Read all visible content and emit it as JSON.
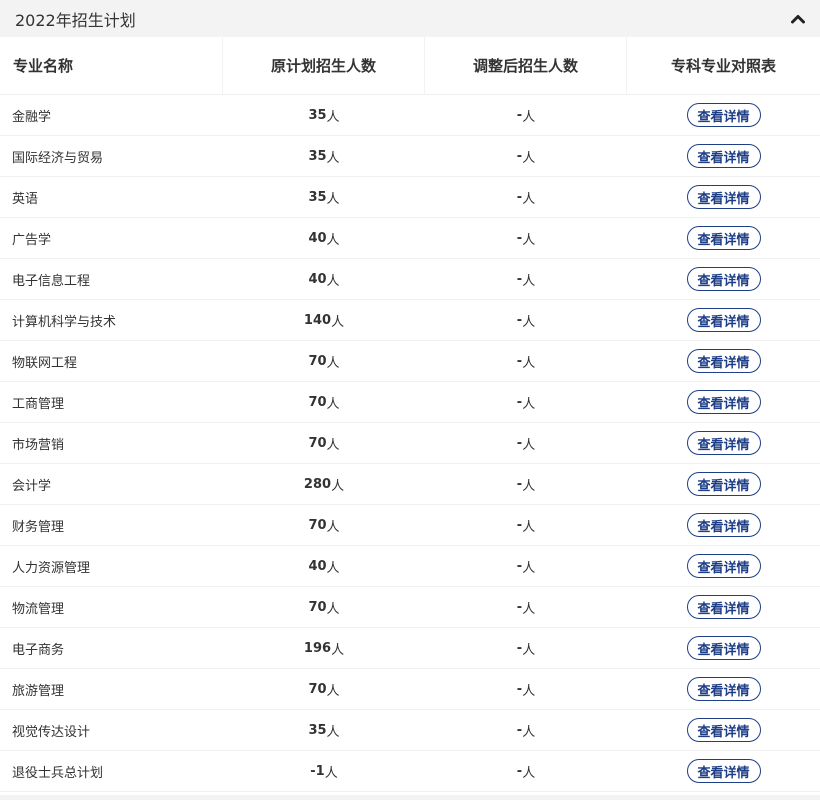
{
  "panel": {
    "title": "2022年招生计划"
  },
  "table": {
    "headers": {
      "major": "专业名称",
      "original": "原计划招生人数",
      "adjusted": "调整后招生人数",
      "compare": "专科专业对照表"
    },
    "unit": "人",
    "button_label": "查看详情",
    "rows": [
      {
        "major": "金融学",
        "original": "35",
        "adjusted": "-"
      },
      {
        "major": "国际经济与贸易",
        "original": "35",
        "adjusted": "-"
      },
      {
        "major": "英语",
        "original": "35",
        "adjusted": "-"
      },
      {
        "major": "广告学",
        "original": "40",
        "adjusted": "-"
      },
      {
        "major": "电子信息工程",
        "original": "40",
        "adjusted": "-"
      },
      {
        "major": "计算机科学与技术",
        "original": "140",
        "adjusted": "-"
      },
      {
        "major": "物联网工程",
        "original": "70",
        "adjusted": "-"
      },
      {
        "major": "工商管理",
        "original": "70",
        "adjusted": "-"
      },
      {
        "major": "市场营销",
        "original": "70",
        "adjusted": "-"
      },
      {
        "major": "会计学",
        "original": "280",
        "adjusted": "-"
      },
      {
        "major": "财务管理",
        "original": "70",
        "adjusted": "-"
      },
      {
        "major": "人力资源管理",
        "original": "40",
        "adjusted": "-"
      },
      {
        "major": "物流管理",
        "original": "70",
        "adjusted": "-"
      },
      {
        "major": "电子商务",
        "original": "196",
        "adjusted": "-"
      },
      {
        "major": "旅游管理",
        "original": "70",
        "adjusted": "-"
      },
      {
        "major": "视觉传达设计",
        "original": "35",
        "adjusted": "-"
      },
      {
        "major": "退役士兵总计划",
        "original": "-1",
        "adjusted": "-"
      }
    ]
  },
  "colors": {
    "header_bg": "#f3f3f3",
    "button_accent": "#1e3f87",
    "text": "#333333"
  },
  "icons": {
    "collapse": "chevron-up-icon"
  }
}
